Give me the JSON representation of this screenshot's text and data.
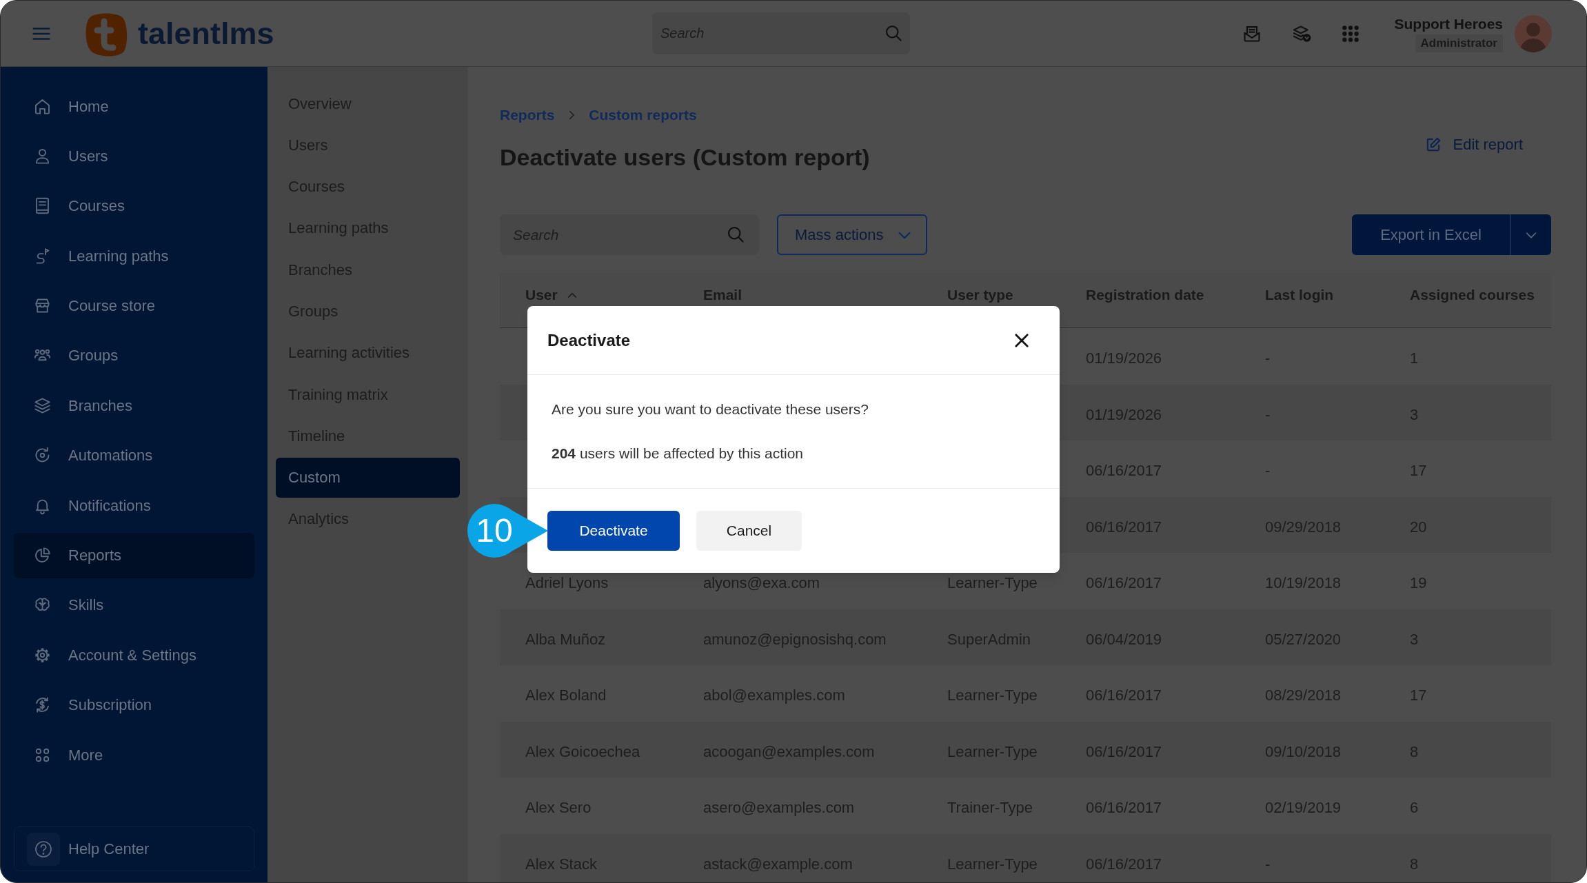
{
  "topbar": {
    "logo": {
      "wordmark": "talentlms"
    },
    "search": {
      "placeholder": "Search"
    },
    "user": {
      "name": "Support Heroes",
      "role": "Administrator"
    }
  },
  "sidebar": {
    "items": [
      {
        "label": "Home",
        "selected": false
      },
      {
        "label": "Users",
        "selected": false
      },
      {
        "label": "Courses",
        "selected": false
      },
      {
        "label": "Learning paths",
        "selected": false
      },
      {
        "label": "Course store",
        "selected": false
      },
      {
        "label": "Groups",
        "selected": false
      },
      {
        "label": "Branches",
        "selected": false
      },
      {
        "label": "Automations",
        "selected": false
      },
      {
        "label": "Notifications",
        "selected": false
      },
      {
        "label": "Reports",
        "selected": true
      },
      {
        "label": "Skills",
        "selected": false
      },
      {
        "label": "Account & Settings",
        "selected": false
      },
      {
        "label": "Subscription",
        "selected": false
      },
      {
        "label": "More",
        "selected": false
      }
    ],
    "help": {
      "label": "Help Center"
    }
  },
  "report_menu": {
    "items": [
      {
        "label": "Overview",
        "selected": false
      },
      {
        "label": "Users",
        "selected": false
      },
      {
        "label": "Courses",
        "selected": false
      },
      {
        "label": "Learning paths",
        "selected": false
      },
      {
        "label": "Branches",
        "selected": false
      },
      {
        "label": "Groups",
        "selected": false
      },
      {
        "label": "Learning activities",
        "selected": false
      },
      {
        "label": "Training matrix",
        "selected": false
      },
      {
        "label": "Timeline",
        "selected": false
      },
      {
        "label": "Custom",
        "selected": true
      },
      {
        "label": "Analytics",
        "selected": false
      }
    ]
  },
  "breadcrumbs": [
    {
      "label": "Reports"
    },
    {
      "label": "Custom reports"
    }
  ],
  "page_title": "Deactivate users (Custom report)",
  "edit_link": {
    "label": "Edit report"
  },
  "toolbar": {
    "search": {
      "placeholder": "Search"
    },
    "mass_actions": {
      "label": "Mass actions"
    },
    "export": {
      "label": "Export in Excel"
    }
  },
  "table": {
    "columns": [
      {
        "label": "User",
        "sorted": true
      },
      {
        "label": "Email",
        "sorted": false
      },
      {
        "label": "User type",
        "sorted": false
      },
      {
        "label": "Registration date",
        "sorted": false
      },
      {
        "label": "Last login",
        "sorted": false
      },
      {
        "label": "Assigned courses",
        "sorted": false
      }
    ],
    "rows": [
      {
        "registration_date": "01/19/2026",
        "last_login": "-",
        "assigned_courses": "1"
      },
      {
        "registration_date": "01/19/2026",
        "last_login": "-",
        "assigned_courses": "3"
      },
      {
        "registration_date": "06/16/2017",
        "last_login": "-",
        "assigned_courses": "17"
      },
      {
        "registration_date": "06/16/2017",
        "last_login": "09/29/2018",
        "assigned_courses": "20"
      },
      {
        "user": "Adriel Lyons",
        "email": "alyons@exa.com",
        "user_type": "Learner-Type",
        "registration_date": "06/16/2017",
        "last_login": "10/19/2018",
        "assigned_courses": "19"
      },
      {
        "user": "Alba Muñoz",
        "email": "amunoz@epignosishq.com",
        "user_type": "SuperAdmin",
        "registration_date": "06/04/2019",
        "last_login": "05/27/2020",
        "assigned_courses": "3"
      },
      {
        "user": "Alex Boland",
        "email": "abol@examples.com",
        "user_type": "Learner-Type",
        "registration_date": "06/16/2017",
        "last_login": "08/29/2018",
        "assigned_courses": "17"
      },
      {
        "user": "Alex Goicoechea",
        "email": "acoogan@examples.com",
        "user_type": "Learner-Type",
        "registration_date": "06/16/2017",
        "last_login": "09/10/2018",
        "assigned_courses": "8"
      },
      {
        "user": "Alex Sero",
        "email": "asero@examples.com",
        "user_type": "Trainer-Type",
        "registration_date": "06/16/2017",
        "last_login": "02/19/2019",
        "assigned_courses": "6"
      },
      {
        "user": "Alex Stack",
        "email": "astack@example.com",
        "user_type": "Learner-Type",
        "registration_date": "06/16/2017",
        "last_login": "-",
        "assigned_courses": "8"
      }
    ]
  },
  "dialog": {
    "title": "Deactivate",
    "message": "Are you sure you want to deactivate these users?",
    "impact": "**204** users will be affected by this action",
    "buttons": [
      {
        "label": "Deactivate",
        "kind": "primary"
      },
      {
        "label": "Cancel",
        "kind": "secondary"
      }
    ]
  },
  "callout": {
    "label": "10"
  }
}
